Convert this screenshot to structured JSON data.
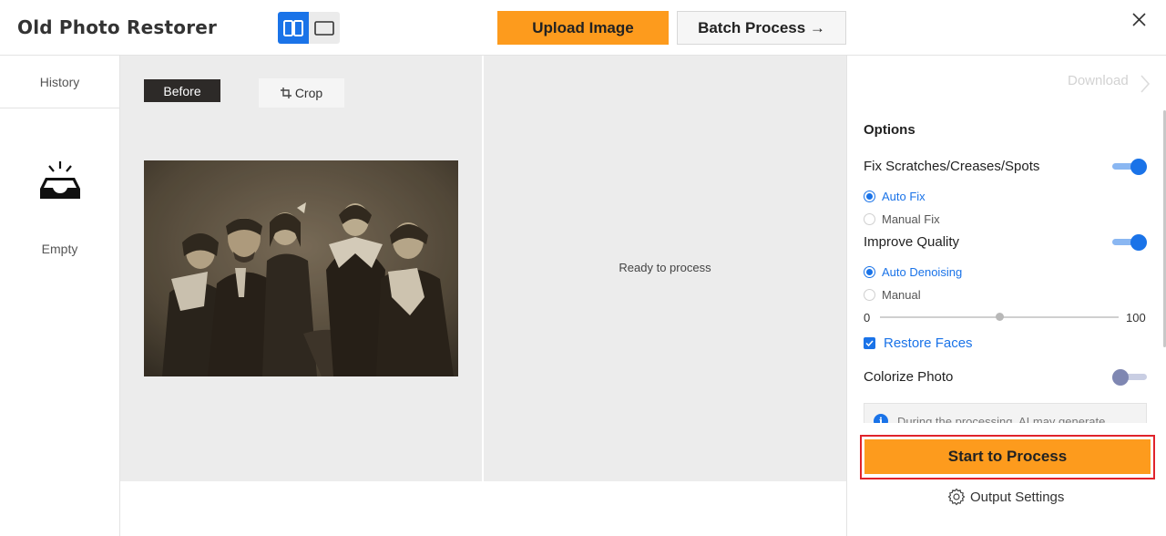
{
  "header": {
    "app_title": "Old Photo Restorer",
    "upload_label": "Upload Image",
    "batch_label": "Batch Process →",
    "view_mode": "split"
  },
  "history": {
    "tab_label": "History",
    "empty_label": "Empty"
  },
  "before_pane": {
    "tag_label": "Before",
    "crop_label": "Crop"
  },
  "after_pane": {
    "status_text": "Ready to process"
  },
  "options": {
    "download_label": "Download",
    "title": "Options",
    "fix_scratches": {
      "label": "Fix Scratches/Creases/Spots",
      "enabled": true,
      "modes": [
        {
          "label": "Auto Fix",
          "selected": true
        },
        {
          "label": "Manual Fix",
          "selected": false
        }
      ]
    },
    "improve_quality": {
      "label": "Improve Quality",
      "enabled": true,
      "modes": [
        {
          "label": "Auto Denoising",
          "selected": true
        },
        {
          "label": "Manual",
          "selected": false
        }
      ],
      "slider": {
        "min": "0",
        "max": "100",
        "value": 50
      }
    },
    "restore_faces": {
      "label": "Restore Faces",
      "checked": true
    },
    "colorize": {
      "label": "Colorize Photo",
      "enabled": false
    },
    "notice_text": "During the processing, AI may generate",
    "start_label": "Start to Process",
    "output_settings_label": "Output Settings"
  },
  "colors": {
    "accent": "#1a73e8",
    "primary_button": "#fd9b1d",
    "highlight": "#e0232b"
  }
}
